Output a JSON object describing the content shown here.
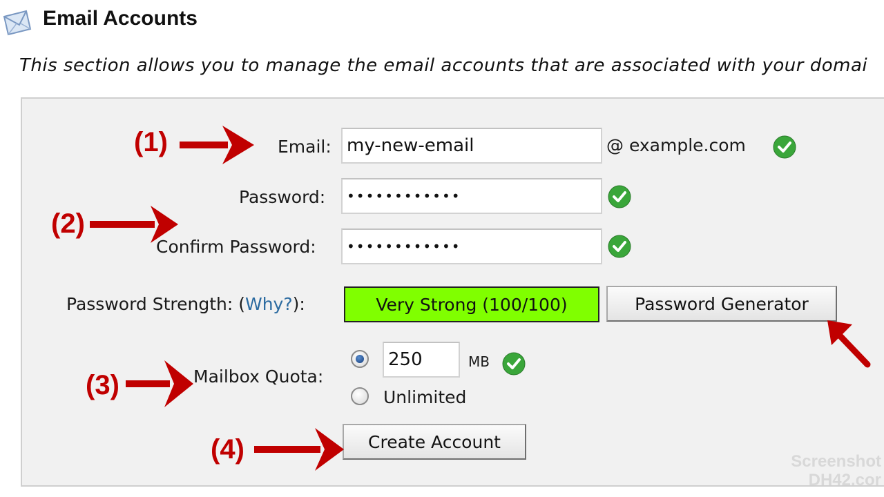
{
  "header": {
    "title": "Email Accounts",
    "icon": "envelope-icon",
    "description": "This section allows you to manage the email accounts that are associated with your domai"
  },
  "form": {
    "email_label": "Email:",
    "email_value": "my-new-email",
    "domain_suffix": "@ example.com",
    "password_label": "Password:",
    "password_value": "••••••••••••",
    "confirm_label": "Confirm Password:",
    "confirm_value": "••••••••••••",
    "strength_label_prefix": "Password Strength: (",
    "strength_why_link": "Why?",
    "strength_label_suffix": "):",
    "strength_value": "Very Strong (100/100)",
    "strength_color": "#80ff00",
    "generator_button": "Password Generator",
    "quota_label": "Mailbox Quota:",
    "quota_value": "250",
    "quota_unit": "MB",
    "quota_unlimited_label": "Unlimited",
    "quota_selected": "value",
    "create_button": "Create Account"
  },
  "annotations": {
    "step1": "(1)",
    "step2": "(2)",
    "step3": "(3)",
    "step4": "(4)",
    "color": "#c00000"
  },
  "watermark": {
    "line1": "Screenshot",
    "line2": "DH42.cor"
  },
  "colors": {
    "panel_bg": "#f1f1f1",
    "link": "#2a6aa0",
    "check": "#3aa63a"
  }
}
